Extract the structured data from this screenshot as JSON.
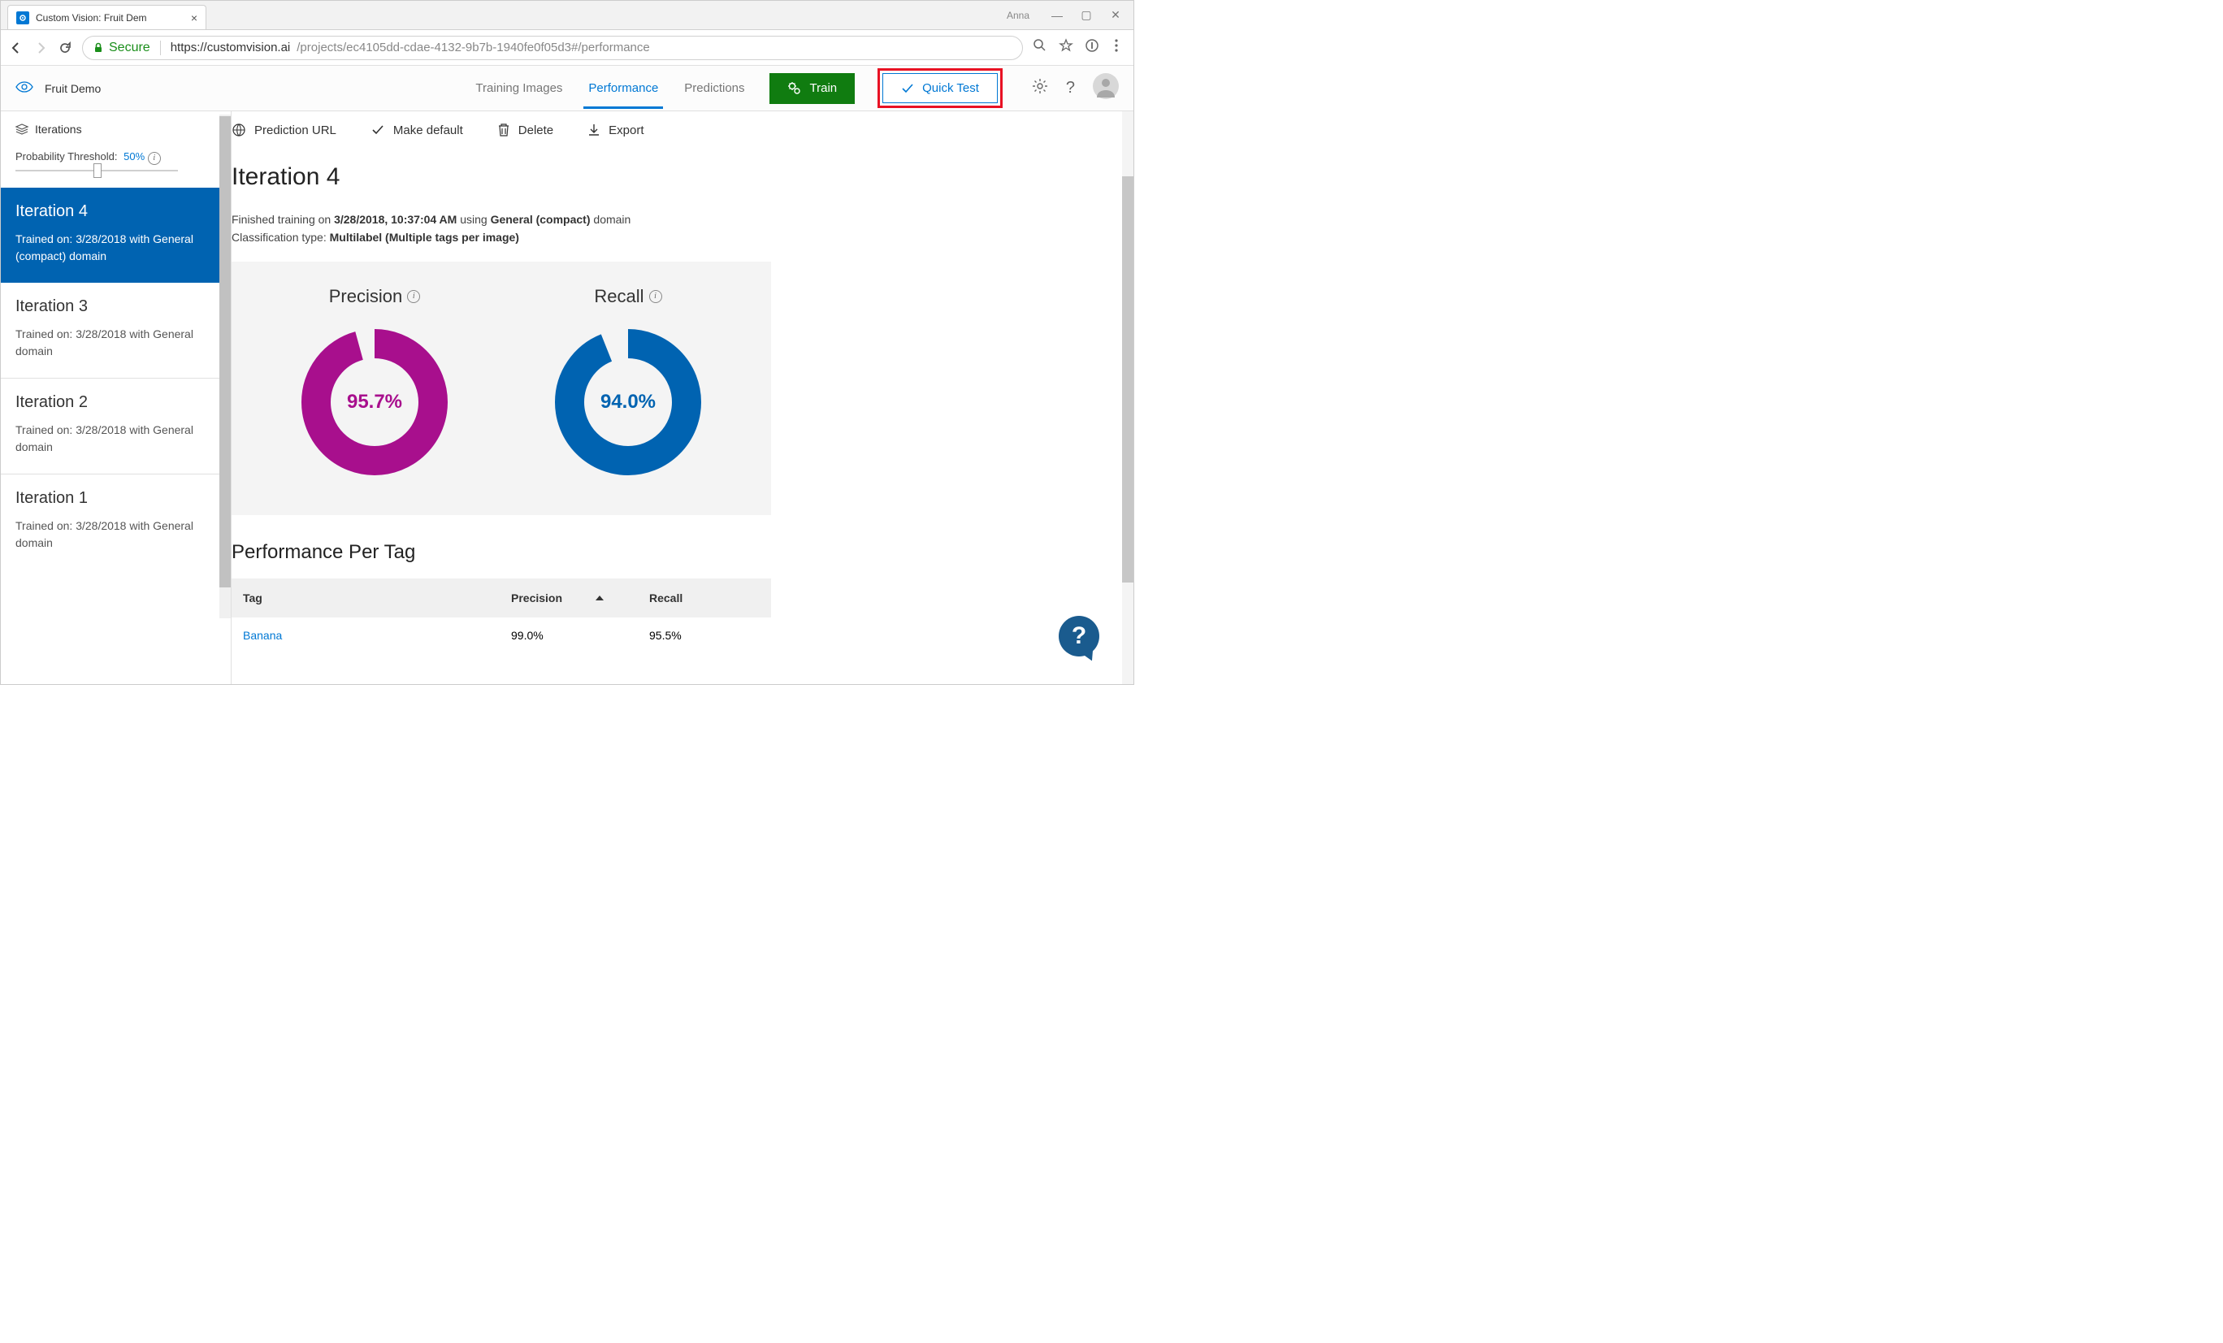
{
  "browser": {
    "tab_title": "Custom Vision: Fruit Dem",
    "user_label": "Anna",
    "secure_label": "Secure",
    "url_authority": "https://customvision.ai",
    "url_path": "/projects/ec4105dd-cdae-4132-9b7b-1940fe0f05d3#/performance"
  },
  "header": {
    "project_name": "Fruit Demo",
    "tabs": {
      "training_images": "Training Images",
      "performance": "Performance",
      "predictions": "Predictions"
    },
    "train_btn": "Train",
    "quick_test_btn": "Quick Test"
  },
  "sidebar": {
    "iterations_label": "Iterations",
    "threshold_label": "Probability Threshold:",
    "threshold_value": "50%",
    "items": [
      {
        "title": "Iteration 4",
        "sub": "Trained on: 3/28/2018 with General (compact) domain"
      },
      {
        "title": "Iteration 3",
        "sub": "Trained on: 3/28/2018 with General domain"
      },
      {
        "title": "Iteration 2",
        "sub": "Trained on: 3/28/2018 with General domain"
      },
      {
        "title": "Iteration 1",
        "sub": "Trained on: 3/28/2018 with General domain"
      }
    ]
  },
  "actions": {
    "prediction_url": "Prediction URL",
    "make_default": "Make default",
    "delete": "Delete",
    "export": "Export"
  },
  "content": {
    "iteration_title": "Iteration 4",
    "finished_prefix": "Finished training on ",
    "finished_time": "3/28/2018, 10:37:04 AM",
    "finished_middle": " using ",
    "finished_domain": "General (compact)",
    "finished_suffix": " domain",
    "class_type_label": "Classification type: ",
    "class_type_value": "Multilabel (Multiple tags per image)",
    "precision_label": "Precision",
    "recall_label": "Recall",
    "precision_value": "95.7%",
    "recall_value": "94.0%",
    "perf_per_tag": "Performance Per Tag",
    "table": {
      "headers": {
        "tag": "Tag",
        "precision": "Precision",
        "recall": "Recall"
      },
      "rows": [
        {
          "tag": "Banana",
          "precision": "99.0%",
          "recall": "95.5%"
        }
      ]
    }
  },
  "chart_data": [
    {
      "type": "pie",
      "title": "Precision",
      "series": [
        {
          "name": "Precision",
          "values": [
            95.7
          ]
        }
      ],
      "ylim": [
        0,
        100
      ],
      "color": "#a80f8d"
    },
    {
      "type": "pie",
      "title": "Recall",
      "series": [
        {
          "name": "Recall",
          "values": [
            94.0
          ]
        }
      ],
      "ylim": [
        0,
        100
      ],
      "color": "#0063b1"
    }
  ]
}
